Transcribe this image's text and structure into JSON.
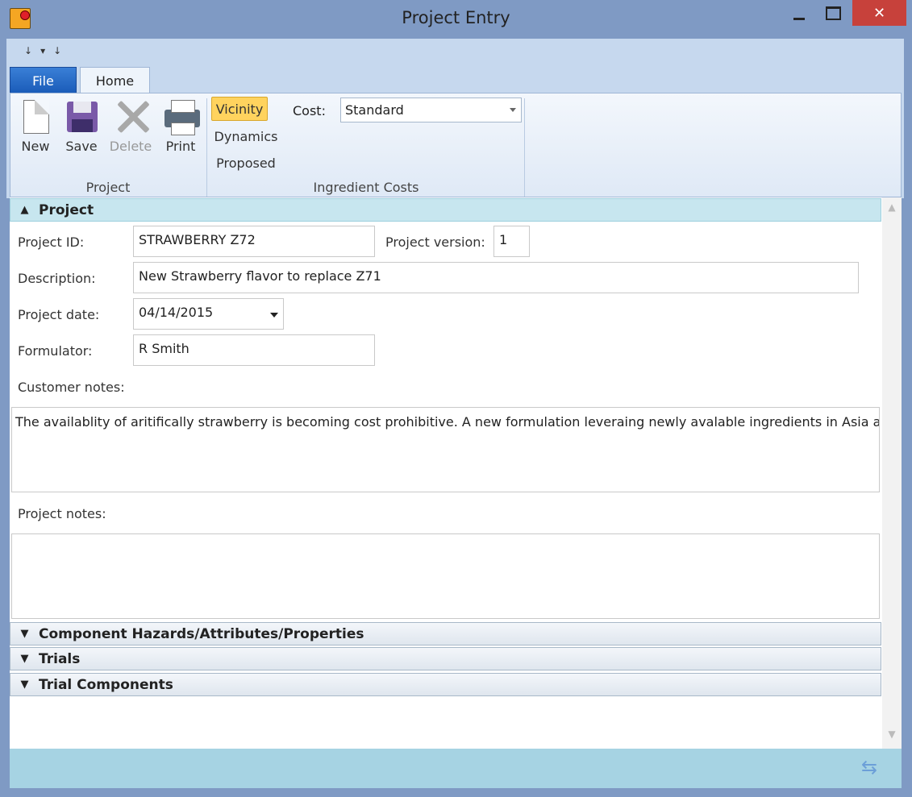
{
  "window": {
    "title": "Project Entry",
    "min_glyph": "",
    "close_glyph": "✕",
    "qat": [
      "↓",
      "▾",
      "↓"
    ]
  },
  "tabs": [
    {
      "label": "File"
    },
    {
      "label": "Home"
    }
  ],
  "ribbon": {
    "project_group": {
      "label": "Project",
      "buttons": [
        {
          "label": "New"
        },
        {
          "label": "Save"
        },
        {
          "label": "Delete"
        },
        {
          "label": "Print"
        }
      ]
    },
    "costs_group": {
      "label": "Ingredient Costs",
      "toggles": [
        {
          "label": "Vicinity"
        },
        {
          "label": "Dynamics"
        },
        {
          "label": "Proposed"
        }
      ],
      "cost_label": "Cost:",
      "cost_value": "Standard"
    }
  },
  "sections": [
    {
      "label": "Project",
      "chevron": "▲"
    },
    {
      "label": "Component Hazards/Attributes/Properties",
      "chevron": "▼"
    },
    {
      "label": "Trials",
      "chevron": "▼"
    },
    {
      "label": "Trial Components",
      "chevron": "▼"
    }
  ],
  "form": {
    "project_id_label": "Project ID:",
    "project_id": "STRAWBERRY Z72",
    "project_version_label": "Project version:",
    "project_version": "1",
    "description_label": "Description:",
    "description": "New Strawberry flavor to replace Z71",
    "project_date_label": "Project date:",
    "project_date": "04/14/2015",
    "formulator_label": "Formulator:",
    "formulator": "R Smith",
    "customer_notes_label": "Customer notes:",
    "customer_notes": "The availablity of aritifically strawberry is becoming cost prohibitive.  A new formulation leveraing newly avalable ingredients in Asia are",
    "project_notes_label": "Project notes:",
    "project_notes": ""
  },
  "scroll": {
    "up": "▲",
    "down": "▼"
  },
  "status": {
    "sync_glyph": "⇆"
  }
}
